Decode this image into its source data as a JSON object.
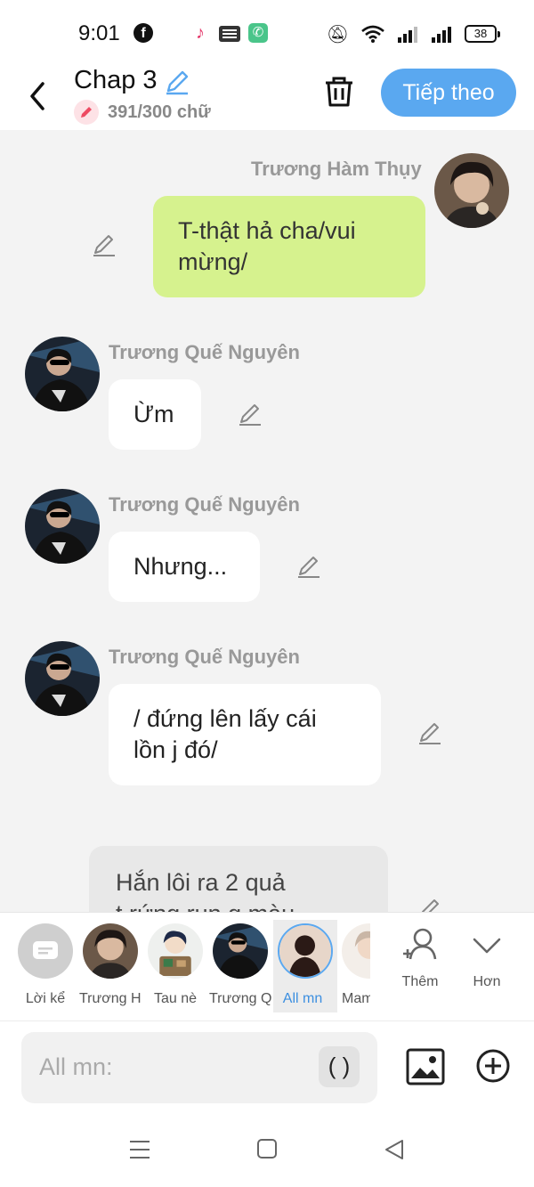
{
  "status_bar": {
    "time": "9:01",
    "battery": "38"
  },
  "header": {
    "title": "Chap 3",
    "word_count": "391/300 chữ",
    "next_label": "Tiếp theo"
  },
  "messages": [
    {
      "sender": "Trương Hàm Thụy",
      "text_lines": [
        "T-thật hả cha/vui",
        "mừng/"
      ],
      "side": "right"
    },
    {
      "sender": "Trương Quế Nguyên",
      "text_lines": [
        "Ừm"
      ],
      "side": "left"
    },
    {
      "sender": "Trương Quế Nguyên",
      "text_lines": [
        "Nhưng..."
      ],
      "side": "left"
    },
    {
      "sender": "Trương Quế Nguyên",
      "text_lines": [
        "/ đứng lên lấy cái",
        "lồn j đó/"
      ],
      "side": "left"
    },
    {
      "sender": "",
      "text_lines": [
        "Hắn lôi ra 2 quả",
        "t rứng run g màu"
      ],
      "side": "narration"
    }
  ],
  "characters": [
    {
      "label": "Lời kể"
    },
    {
      "label": "Trương H..."
    },
    {
      "label": "Tau nè"
    },
    {
      "label": "Trương Q..."
    },
    {
      "label": "All mn",
      "selected": true
    },
    {
      "label": "Mam"
    }
  ],
  "char_actions": {
    "add_label": "Thêm",
    "more_label": "Hơn"
  },
  "input": {
    "placeholder": "All mn:",
    "paren_label": "( )"
  },
  "colors": {
    "accent": "#5aa8f0",
    "my_bubble": "#d6f28e",
    "background": "#f3f3f3"
  }
}
